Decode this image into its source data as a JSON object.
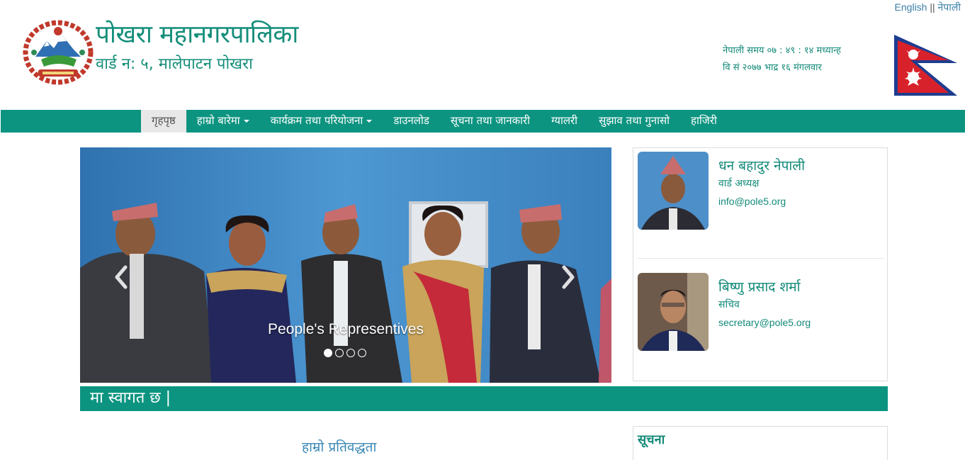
{
  "language": {
    "english": "English",
    "separator": "||",
    "nepali": "नेपाली"
  },
  "header": {
    "title": "पोखरा महानगरपालिका",
    "subtitle": "वार्ड न: ५, मालेपाटन पोखरा",
    "time_line": "नेपाली समय ०७ : ४९ : १४ मध्यान्ह",
    "date_line": "वि सं २०७७ भाद्र १६ मंगलवार"
  },
  "nav": {
    "items": [
      {
        "label": "गृहपृष्ठ",
        "active": true,
        "dropdown": false
      },
      {
        "label": "हाम्रो बारेमा",
        "active": false,
        "dropdown": true
      },
      {
        "label": "कार्यक्रम तथा परियोजना",
        "active": false,
        "dropdown": true
      },
      {
        "label": "डाउनलोड",
        "active": false,
        "dropdown": false
      },
      {
        "label": "सूचना तथा जानकारी",
        "active": false,
        "dropdown": false
      },
      {
        "label": "ग्यालरी",
        "active": false,
        "dropdown": false
      },
      {
        "label": "सुझाव तथा गुनासो",
        "active": false,
        "dropdown": false
      },
      {
        "label": "हाजिरी",
        "active": false,
        "dropdown": false
      }
    ]
  },
  "carousel": {
    "caption": "People's Representives",
    "slide_count": 4,
    "active_index": 0
  },
  "people": [
    {
      "name": "धन बहादुर नेपाली",
      "role": "वार्ड अध्यक्ष",
      "email": "info@pole5.org"
    },
    {
      "name": "बिष्णु प्रसाद शर्मा",
      "role": "सचिव",
      "email": "secretary@pole5.org"
    }
  ],
  "welcome_text": "मा स्वागत छ |",
  "commitment_heading": "हाम्रो प्रतिवद्धता",
  "notice_heading": "सूचना",
  "colors": {
    "brand_green": "#0c9480",
    "text_green": "#138a79",
    "link_blue": "#3a87b4"
  }
}
